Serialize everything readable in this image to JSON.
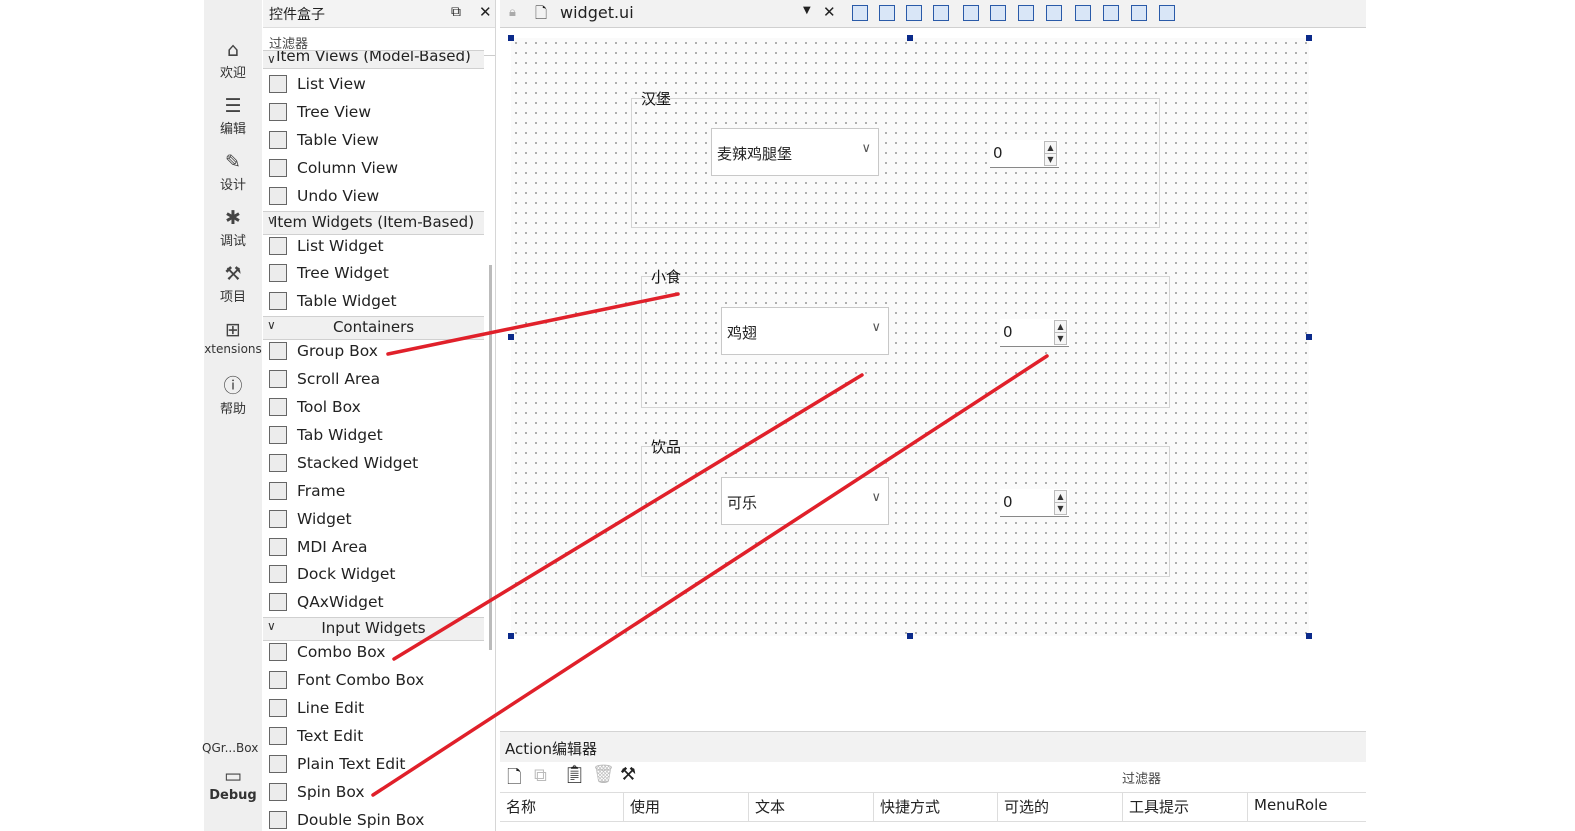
{
  "modes": [
    {
      "label": "欢迎",
      "icon": "home-icon"
    },
    {
      "label": "编辑",
      "icon": "edit-icon"
    },
    {
      "label": "设计",
      "icon": "pen-icon"
    },
    {
      "label": "调试",
      "icon": "bug-icon"
    },
    {
      "label": "项目",
      "icon": "wrench-icon"
    },
    {
      "label": "xtensions",
      "icon": "extensions-icon"
    },
    {
      "label": "帮助",
      "icon": "help-icon"
    }
  ],
  "run_target": {
    "project": "QGr...Box",
    "config": "Debug",
    "icon": "monitor-icon"
  },
  "widget_box": {
    "title": "控件盒子",
    "filter": "过滤器",
    "partial_category": "Item Views (Model-Based)",
    "item_views": [
      "List View",
      "Tree View",
      "Table View",
      "Column View",
      "Undo View"
    ],
    "item_widgets_label": "Item Widgets (Item-Based)",
    "item_widgets": [
      "List Widget",
      "Tree Widget",
      "Table Widget"
    ],
    "containers_label": "Containers",
    "containers": [
      "Group Box",
      "Scroll Area",
      "Tool Box",
      "Tab Widget",
      "Stacked Widget",
      "Frame",
      "Widget",
      "MDI Area",
      "Dock Widget",
      "QAxWidget"
    ],
    "input_label": "Input Widgets",
    "inputs": [
      "Combo Box",
      "Font Combo Box",
      "Line Edit",
      "Text Edit",
      "Plain Text Edit",
      "Spin Box",
      "Double Spin Box"
    ]
  },
  "editor": {
    "filename": "widget.ui"
  },
  "form": {
    "groups": [
      {
        "title": "汉堡",
        "combo": "麦辣鸡腿堡",
        "spin": "0"
      },
      {
        "title": "小食",
        "combo": "鸡翅",
        "spin": "0"
      },
      {
        "title": "饮品",
        "combo": "可乐",
        "spin": "0"
      }
    ]
  },
  "action_editor": {
    "title": "Action编辑器",
    "filter": "过滤器",
    "columns": [
      "名称",
      "使用",
      "文本",
      "快捷方式",
      "可选的",
      "工具提示",
      "MenuRole"
    ]
  },
  "colors": {
    "annotation": "#e0202a",
    "handle": "#0b2a8a"
  }
}
